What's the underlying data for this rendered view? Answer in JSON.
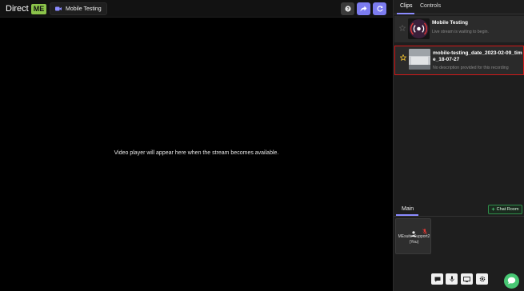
{
  "header": {
    "logo_text": "Direct",
    "logo_badge": "ME",
    "stream_title": "Mobile Testing",
    "accent_color": "#7c7cf0"
  },
  "video": {
    "placeholder": "Video player will appear here when the stream becomes available."
  },
  "panel": {
    "tabs": [
      "Clips",
      "Controls"
    ],
    "active_tab": "Clips",
    "clips": [
      {
        "title": "Mobile Testing",
        "description": "Live stream is waiting to begin.",
        "starred": false,
        "thumb_icon": "broadcast-icon"
      },
      {
        "title": "mobile-testing_date_2023-02-09_time_18-07-27",
        "description": "No description provided for this recording",
        "starred": true,
        "selected": true,
        "highlight_color": "#d01818"
      }
    ],
    "main_tab": "Main",
    "chat_room_label": "Chat Room",
    "participants": [
      {
        "name": "MEsuite Support2 (You)",
        "muted": true
      }
    ],
    "controls": [
      "chat-icon",
      "mic-icon",
      "screen-share-icon",
      "settings-icon"
    ],
    "fab_icon": "chat-bubble-icon",
    "fab_color": "#48c774"
  }
}
